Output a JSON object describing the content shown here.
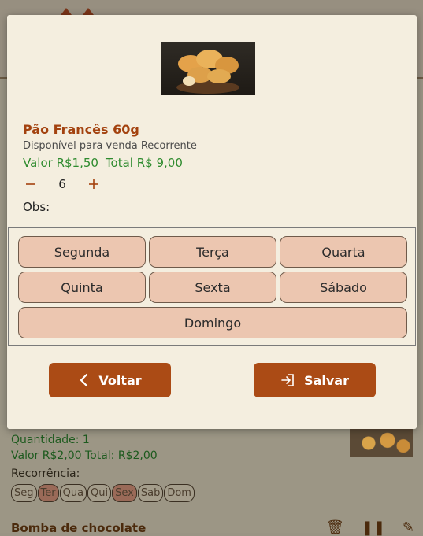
{
  "background": {
    "item": {
      "quantity_text": "Quantidade: 1",
      "price_text": "Valor R$2,00  Total: R$2,00",
      "recurrence_label": "Recorrência:",
      "days": [
        "Seg",
        "Ter",
        "Qua",
        "Qui",
        "Sex",
        "Sab",
        "Dom"
      ],
      "selected_days": [
        "Ter",
        "Sex"
      ]
    },
    "next_item_title": "Bomba de chocolate"
  },
  "modal": {
    "product": {
      "name": "Pão Francês 60g",
      "availability": "Disponível para venda Recorrente",
      "unit_price": "Valor R$1,50",
      "total_price": "Total R$ 9,00",
      "quantity": "6",
      "obs_label": "Obs:"
    },
    "days": [
      "Segunda",
      "Terça",
      "Quarta",
      "Quinta",
      "Sexta",
      "Sábado",
      "Domingo"
    ],
    "buttons": {
      "back": "Voltar",
      "save": "Salvar"
    }
  },
  "colors": {
    "accent": "#ab4b15",
    "price_green": "#2e8b2e",
    "day_chip": "#ecc6b0",
    "modal_bg": "#f4eedf"
  }
}
